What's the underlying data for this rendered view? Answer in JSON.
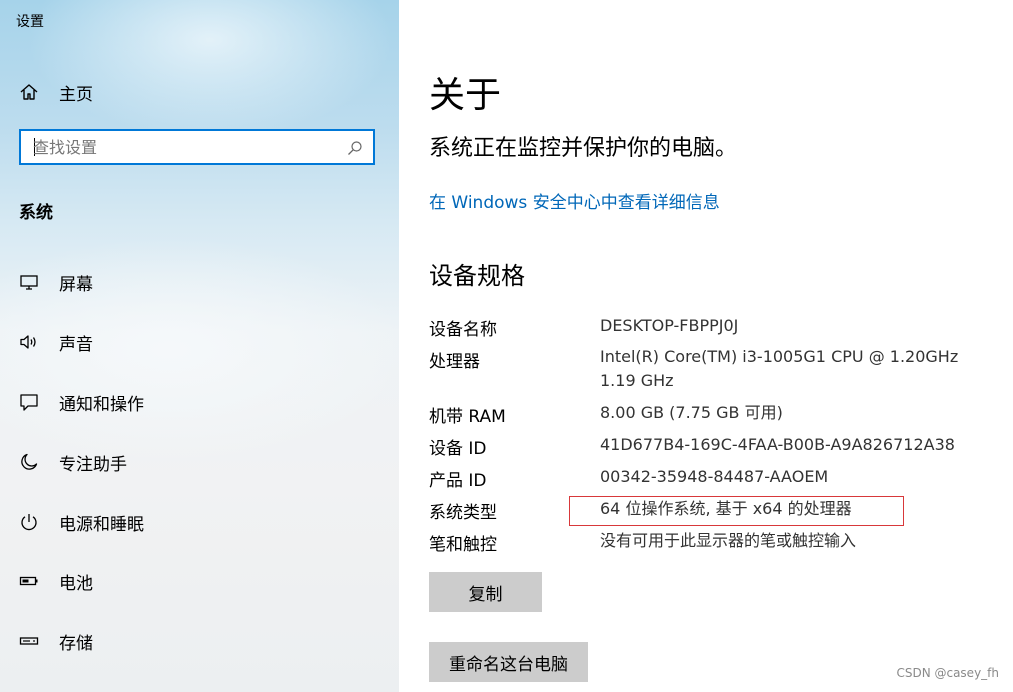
{
  "window": {
    "title": "设置"
  },
  "sidebar": {
    "home": {
      "label": "主页",
      "icon": "home-icon"
    },
    "search": {
      "placeholder": "查找设置",
      "value": ""
    },
    "section_title": "系统",
    "items": [
      {
        "label": "屏幕",
        "icon": "display-icon"
      },
      {
        "label": "声音",
        "icon": "speaker-icon"
      },
      {
        "label": "通知和操作",
        "icon": "notification-icon"
      },
      {
        "label": "专注助手",
        "icon": "moon-icon"
      },
      {
        "label": "电源和睡眠",
        "icon": "power-icon"
      },
      {
        "label": "电池",
        "icon": "battery-icon"
      },
      {
        "label": "存储",
        "icon": "storage-icon"
      }
    ]
  },
  "main": {
    "title": "关于",
    "status": "系统正在监控并保护你的电脑。",
    "security_link": "在 Windows 安全中心中查看详细信息",
    "specs_title": "设备规格",
    "specs": [
      {
        "label": "设备名称",
        "value": "DESKTOP-FBPPJ0J"
      },
      {
        "label": "处理器",
        "value": "Intel(R) Core(TM) i3-1005G1 CPU @ 1.20GHz   1.19 GHz"
      },
      {
        "label": "机带 RAM",
        "value": "8.00 GB (7.75 GB 可用)"
      },
      {
        "label": "设备 ID",
        "value": "41D677B4-169C-4FAA-B00B-A9A826712A38"
      },
      {
        "label": "产品 ID",
        "value": "00342-35948-84487-AAOEM"
      },
      {
        "label": "系统类型",
        "value": "64 位操作系统, 基于 x64 的处理器"
      },
      {
        "label": "笔和触控",
        "value": "没有可用于此显示器的笔或触控输入"
      }
    ],
    "copy_button": "复制",
    "rename_button": "重命名这台电脑"
  },
  "watermark": "CSDN @casey_fh",
  "colors": {
    "accent": "#0078d7",
    "link": "#0067b8",
    "highlight_border": "#d8383a",
    "button_bg": "#cccccc"
  }
}
